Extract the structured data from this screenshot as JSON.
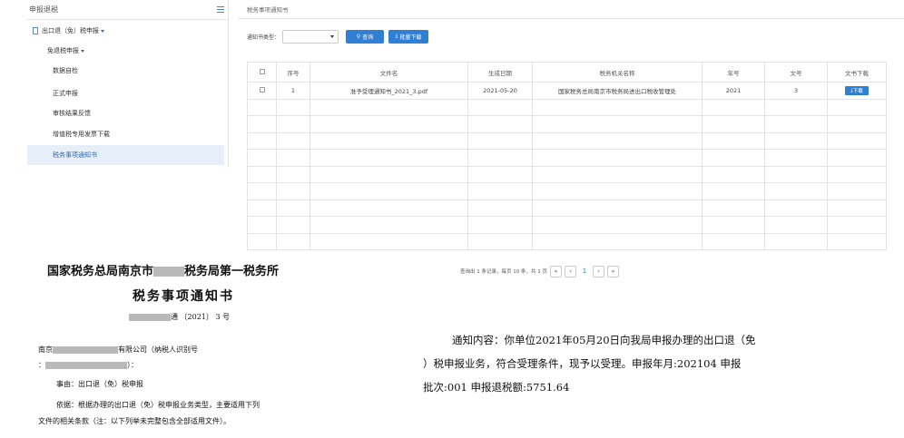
{
  "sidebar": {
    "title": "申报退税",
    "items": [
      {
        "label": "出口退（免）税申报"
      },
      {
        "label": "免退税申报"
      },
      {
        "label": "数据自检"
      },
      {
        "label": "正式申报"
      },
      {
        "label": "审核结果反馈"
      },
      {
        "label": "增值税专用发票下载"
      },
      {
        "label": "税务事项通知书"
      }
    ]
  },
  "main": {
    "tab_title": "税务事项通知书",
    "filter": {
      "label": "通知书类型：",
      "select_value": "",
      "query_button": "查询",
      "batch_button": "批量下载"
    },
    "table": {
      "headers": [
        "",
        "序号",
        "文件名",
        "生成日期",
        "税务机关名称",
        "年号",
        "文号",
        "文书下载"
      ],
      "rows": [
        {
          "index": "1",
          "filename": "准予受理通知书_2021_3.pdf",
          "date": "2021-05-20",
          "authority": "国家税务总局南京市税务局进出口税收管理处",
          "year": "2021",
          "number": "3",
          "download": "下载"
        }
      ]
    },
    "pager": {
      "summary": "查询出 1 条记录，每页 10 条，共 1 页",
      "first": "«",
      "prev": "‹",
      "current": "1",
      "next": "›",
      "last": "»"
    }
  },
  "document": {
    "org_prefix": "国家税务总局南京市",
    "org_suffix": "税务局第一税务所",
    "title": "税务事项通知书",
    "doc_no_suffix": "通  〔2021〕 3 号",
    "p1_prefix": "南京",
    "p1_suffix": "有限公司（纳税人识别号",
    "p2_prefix": "：",
    "p2_suffix": "）：",
    "p3": "事由：出口退（免）税申报",
    "p4": "依据：根据办理的出口退（免）税申报业务类型，主要适用下列",
    "p5": "文件的相关条款（注：以下列举未完整包含全部适用文件）。"
  },
  "notice": {
    "line1": "通知内容：你单位2021年05月20日向我局申报办理的出口退（免",
    "line2": "）税申报业务，符合受理条件，现予以受理。申报年月:202104 申报",
    "line3": "批次:001 申报退税额:5751.64"
  }
}
